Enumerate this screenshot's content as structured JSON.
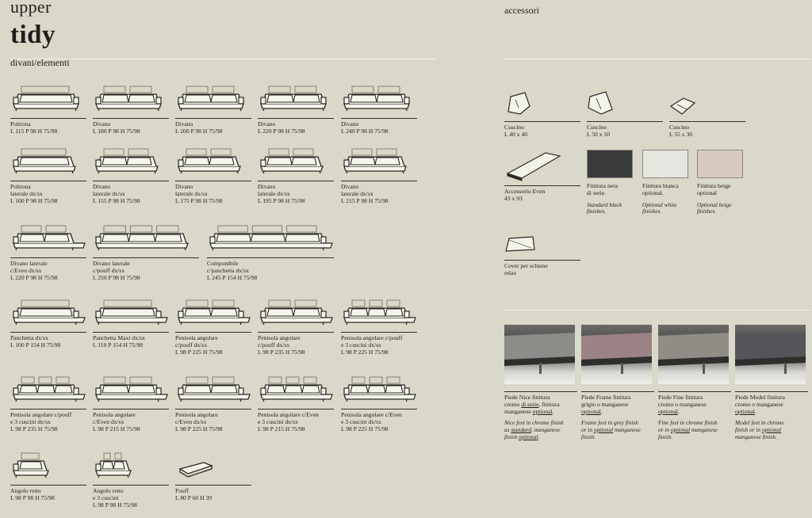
{
  "header": {
    "brand": "upper",
    "model": "tidy",
    "section": "divani/elementi",
    "accessories": "accessori"
  },
  "elements": [
    {
      "name": "Poltrona",
      "dims": "L 115 P 98 H 75/98",
      "seats": 1,
      "kind": "sofa"
    },
    {
      "name": "Divano",
      "dims": "L 180 P 98 H 75/98",
      "seats": 2,
      "kind": "sofa"
    },
    {
      "name": "Divano",
      "dims": "L 200 P 98 H 75/98",
      "seats": 2,
      "kind": "sofa"
    },
    {
      "name": "Divano",
      "dims": "L 220 P 98 H 75/98",
      "seats": 2,
      "kind": "sofa"
    },
    {
      "name": "Divano",
      "dims": "L 240 P 98 H 75/98",
      "seats": 2,
      "kind": "sofa"
    },
    {
      "name": "Poltrona\nlaterale dx/sx",
      "dims": "L 100 P 98 H 75/98",
      "seats": 1,
      "kind": "side"
    },
    {
      "name": "Divano\nlaterale dx/sx",
      "dims": "L 155 P 98 H 75/98",
      "seats": 2,
      "kind": "side"
    },
    {
      "name": "Divano\nlaterale dx/sx",
      "dims": "L 175 P 98 H 75/98",
      "seats": 2,
      "kind": "side"
    },
    {
      "name": "Divano\nlaterale dx/sx",
      "dims": "L 195 P 98 H 75/98",
      "seats": 2,
      "kind": "side"
    },
    {
      "name": "Divano\nlaterale dx/sx",
      "dims": "L 215 P 98 H 75/98",
      "seats": 2,
      "kind": "side"
    },
    {
      "name": "Divano laterale\nc/Even dx/sx",
      "dims": "L 220 P 98 H 75/98",
      "seats": 2,
      "kind": "even"
    },
    {
      "name": "Divano laterale\nc/pouff dx/sx",
      "dims": "L 250 P 98 H 75/98",
      "seats": 3,
      "kind": "side"
    },
    {
      "name": "Componibile\nc/panchetta dx/sx",
      "dims": "L 245 P 154 H 75/98",
      "seats": 3,
      "kind": "bench"
    },
    {
      "name": "Panchetta dx/sx",
      "dims": "L 100 P 154 H 75/98",
      "seats": 1,
      "kind": "bench"
    },
    {
      "name": "Panchetta Maxi dx/sx",
      "dims": "L 110 P 154 H 75/98",
      "seats": 1,
      "kind": "bench"
    },
    {
      "name": "Penisola angolare\nc/pouff dx/sx",
      "dims": "L 98 P 225 H 75/98",
      "seats": 2,
      "kind": "peninsula"
    },
    {
      "name": "Penisola angolare\nc/pouff dx/sx",
      "dims": "L 98 P 235 H 75/98",
      "seats": 2,
      "kind": "peninsula"
    },
    {
      "name": "Penisola angolare c/pouff\ne 3 cuscini dx/sx",
      "dims": "L 98 P 225 H 75/98",
      "seats": 3,
      "kind": "peninsula"
    },
    {
      "name": "Penisola angolare c/pouff\ne 3 cuscini dx/sx",
      "dims": "L 98 P 235 H 75/98",
      "seats": 3,
      "kind": "peninsula"
    },
    {
      "name": "Penisola angolare\nc/Even dx/sx",
      "dims": "L 98 P 215 H 75/98",
      "seats": 2,
      "kind": "peninsula"
    },
    {
      "name": "Penisola angolare\nc/Even dx/sx",
      "dims": "L 98 P 225 H 75/98",
      "seats": 2,
      "kind": "peninsula"
    },
    {
      "name": "Penisola angolare c/Even\ne 3 cuscini dx/sx",
      "dims": "L 98 P 215 H 75/98",
      "seats": 3,
      "kind": "peninsula"
    },
    {
      "name": "Penisola angolare c/Even\ne 3 cuscini dx/sx",
      "dims": "L 98 P 225 H 75/98",
      "seats": 3,
      "kind": "peninsula"
    },
    {
      "name": "Angolo retto",
      "dims": "L 98 P 98 H 75/98",
      "seats": 1,
      "kind": "corner"
    },
    {
      "name": "Angolo retto\ne 3 cuscini",
      "dims": "L 98 P 98 H 75/98",
      "seats": 2,
      "kind": "corner"
    },
    {
      "name": "Pouff",
      "dims": "L 80 P 60 H 39",
      "seats": 0,
      "kind": "pouff"
    }
  ],
  "accessories": {
    "cushions": [
      {
        "name": "Cuscino",
        "dims": "L 40 x 40"
      },
      {
        "name": "Cuscino",
        "dims": "L 50 x 50"
      },
      {
        "name": "Cuscino",
        "dims": "L 55 x 30"
      }
    ],
    "even": {
      "name": "Accessorio Even",
      "dims": "43 x 93"
    },
    "finishes": [
      {
        "it": "Finitura nera\ndi serie.",
        "en": "Standard black\nfinishes.",
        "color": "#3a3b3c"
      },
      {
        "it": "Finitura bianca\noptional.",
        "en": "Optional white\nfinishes.",
        "color": "#e6e6e1"
      },
      {
        "it": "Finitura beige\noptional",
        "en": "Optional beige\nfinishes.",
        "color": "#d7cbbf"
      }
    ],
    "cover": {
      "name": "Cover per schiene\nrelax"
    },
    "feet": [
      {
        "it_1": "Piede Nice finitura",
        "it_2a": "cromo ",
        "it_2u": "di serie",
        "it_2b": ", finitura",
        "it_3a": "manganese ",
        "it_3u": "optional",
        "it_3b": ".",
        "en_1": "Nice feet in chrome finish",
        "en_2a": "as ",
        "en_2u": "standard",
        "en_2b": ", manganese",
        "en_3a": "finish ",
        "en_3u": "optional",
        "en_3b": ".",
        "fabric": "#8c8c88"
      },
      {
        "it_1": "Piede Frame finitura",
        "it_2a": "grigio o manganese",
        "it_2u": "",
        "it_2b": "",
        "it_3a": "",
        "it_3u": "optional",
        "it_3b": ".",
        "en_1": "Frame feet in grey finish",
        "en_2a": "or in ",
        "en_2u": "optional",
        "en_2b": " manganese",
        "en_3a": "finish.",
        "en_3u": "",
        "en_3b": "",
        "fabric": "#9b8385"
      },
      {
        "it_1": "Piede Fine finitura",
        "it_2a": "cromo o manganese",
        "it_2u": "",
        "it_2b": "",
        "it_3a": "",
        "it_3u": "optional",
        "it_3b": ".",
        "en_1": "Fine feet in chrome finish",
        "en_2a": "or in ",
        "en_2u": "optional",
        "en_2b": " manganese",
        "en_3a": "finish.",
        "en_3u": "",
        "en_3b": "",
        "fabric": "#8f8d86"
      },
      {
        "it_1": "Piede Model finitura",
        "it_2a": "cromo o manganese",
        "it_2u": "",
        "it_2b": "",
        "it_3a": "",
        "it_3u": "optional",
        "it_3b": ".",
        "en_1": "Model feet in chrome",
        "en_2a": "finish or in ",
        "en_2u": "optional",
        "en_2b": "",
        "en_3a": "manganese finish.",
        "en_3u": "",
        "en_3b": "",
        "fabric": "#55565a"
      }
    ]
  }
}
